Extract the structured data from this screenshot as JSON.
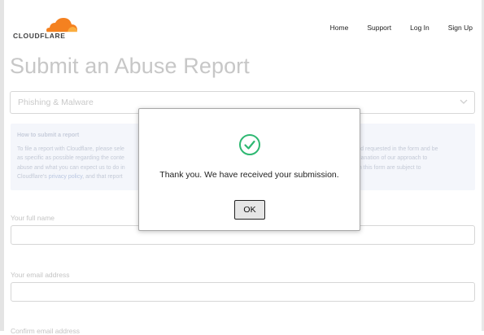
{
  "header": {
    "brand": "CLOUDFLARE",
    "logo_icon": "cloud-icon",
    "brand_color": "#f48120",
    "nav": [
      "Home",
      "Support",
      "Log In",
      "Sign Up"
    ]
  },
  "page": {
    "title": "Submit an Abuse Report"
  },
  "report_type": {
    "selected": "Phishing & Malware",
    "icon": "chevron-down-icon"
  },
  "info_box": {
    "title": "How to submit a report",
    "line1_left": "To file a report with Cloudflare, please sele",
    "line1_right": "ach field requested in the form and be",
    "line2_left": "as specific as possible regarding the conte",
    "line2_right": "an explanation of our approach to",
    "line3_left": "abuse and what you can expect us to do in",
    "line3_right": "through this form are subject to",
    "line4_prefix": "Cloudflare's ",
    "line4_link": "privacy policy",
    "line4_suffix": ", and that report"
  },
  "form": {
    "name_label": "Your full name",
    "email_label": "Your email address",
    "confirm_label": "Confirm email address"
  },
  "dialog": {
    "message": "Thank you. We have received your submission.",
    "ok_label": "OK",
    "icon": "check-circle-icon",
    "icon_color": "#2eb872"
  }
}
